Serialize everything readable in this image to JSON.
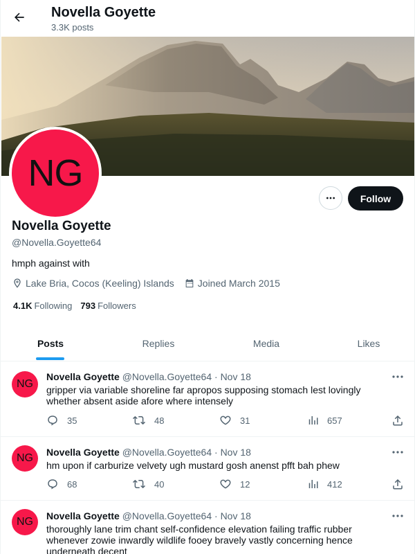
{
  "header": {
    "title": "Novella Goyette",
    "post_count": "3.3K posts"
  },
  "profile": {
    "avatar_initials": "NG",
    "name": "Novella Goyette",
    "handle": "@Novella.Goyette64",
    "bio": "hmph against with",
    "location": "Lake Bria, Cocos (Keeling) Islands",
    "joined": "Joined March 2015",
    "following_count": "4.1K",
    "following_label": "Following",
    "followers_count": "793",
    "followers_label": "Followers",
    "follow_button": "Follow",
    "avatar_color": "#f7184a"
  },
  "tabs": [
    {
      "label": "Posts",
      "active": true
    },
    {
      "label": "Replies",
      "active": false
    },
    {
      "label": "Media",
      "active": false
    },
    {
      "label": "Likes",
      "active": false
    }
  ],
  "posts": [
    {
      "name": "Novella Goyette",
      "handle": "@Novella.Goyette64",
      "separator": "·",
      "date": "Nov 18",
      "text": "gripper via variable shoreline far apropos supposing stomach lest lovingly whether absent aside afore where intensely",
      "replies": "35",
      "reposts": "48",
      "likes": "31",
      "views": "657"
    },
    {
      "name": "Novella Goyette",
      "handle": "@Novella.Goyette64",
      "separator": "·",
      "date": "Nov 18",
      "text": "hm upon if carburize velvety ugh mustard gosh anenst pfft bah phew",
      "replies": "68",
      "reposts": "40",
      "likes": "12",
      "views": "412"
    },
    {
      "name": "Novella Goyette",
      "handle": "@Novella.Goyette64",
      "separator": "·",
      "date": "Nov 18",
      "text": "thoroughly lane trim chant self-confidence elevation failing traffic rubber whenever zowie inwardly wildlife fooey bravely vastly concerning hence underneath decent"
    }
  ],
  "colors": {
    "accent": "#1d9bf0",
    "text": "#0f1419",
    "muted": "#536471"
  }
}
